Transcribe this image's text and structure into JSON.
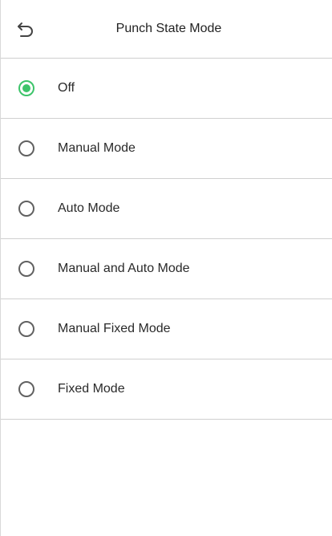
{
  "header": {
    "title": "Punch State Mode",
    "back_icon": "undo-arrow-icon"
  },
  "options": [
    {
      "label": "Off",
      "selected": true
    },
    {
      "label": "Manual Mode",
      "selected": false
    },
    {
      "label": "Auto Mode",
      "selected": false
    },
    {
      "label": "Manual and Auto Mode",
      "selected": false
    },
    {
      "label": "Manual Fixed Mode",
      "selected": false
    },
    {
      "label": "Fixed Mode",
      "selected": false
    }
  ],
  "colors": {
    "accent": "#3dc46a",
    "radio_border": "#616161",
    "divider": "#d0d0d0"
  }
}
